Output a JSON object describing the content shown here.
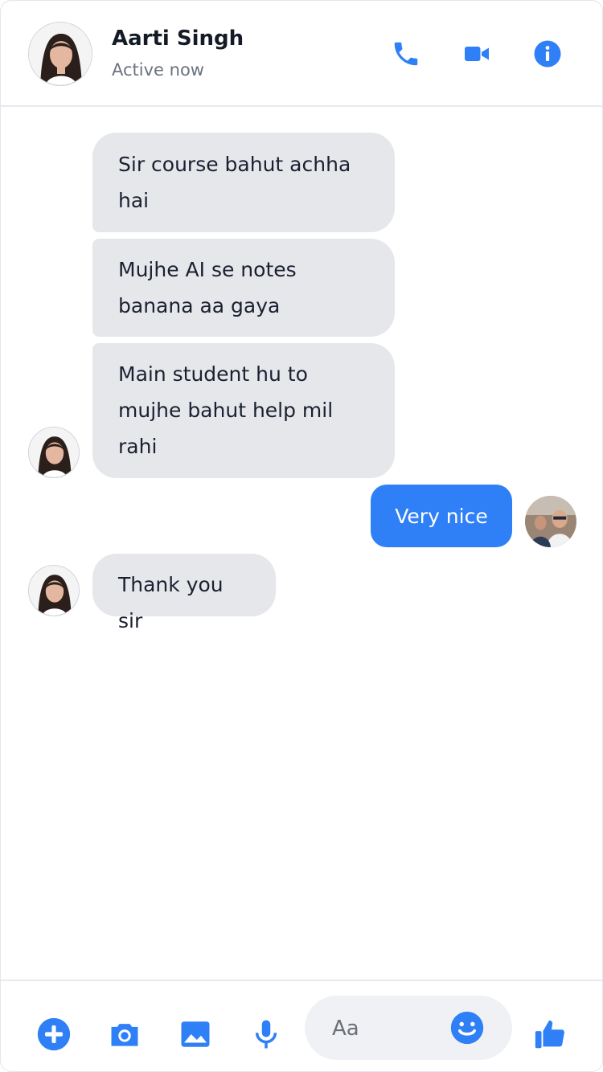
{
  "header": {
    "name": "Aarti Singh",
    "status": "Active now",
    "icons": [
      "phone-icon",
      "video-camera-icon",
      "info-icon"
    ]
  },
  "messages": [
    {
      "from": "Aarti Singh",
      "text": "Sir course bahut achha hai"
    },
    {
      "from": "Aarti Singh",
      "text": "Mujhe AI se notes banana aa gaya"
    },
    {
      "from": "Aarti Singh",
      "text": "Main student hu to mujhe bahut help mil rahi"
    },
    {
      "from": "me",
      "text": "Very nice"
    },
    {
      "from": "Aarti Singh",
      "text": "Thank you sir"
    }
  ],
  "composer": {
    "placeholder": "Aa",
    "icons": [
      "plus-icon",
      "camera-icon",
      "image-icon",
      "microphone-icon",
      "emoji-icon",
      "thumbs-up-icon"
    ]
  },
  "colors": {
    "accent": "#2f80f7",
    "received_bubble": "#e5e7eb",
    "text": "#151b26",
    "muted": "#6b7280"
  }
}
